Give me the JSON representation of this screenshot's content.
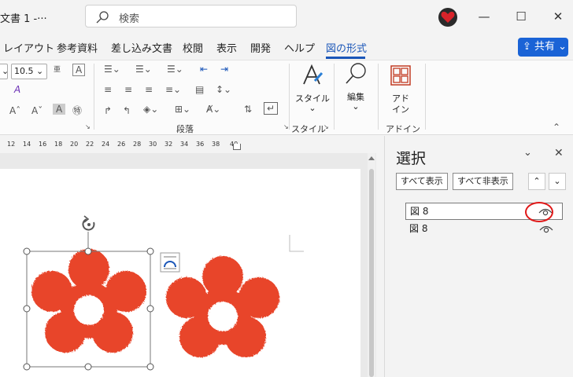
{
  "window": {
    "title": "文書 1  -···",
    "search_placeholder": "検索",
    "minimize": "—",
    "maximize": "☐",
    "close": "✕"
  },
  "menu_tabs": [
    {
      "label": "レイアウト",
      "active": false
    },
    {
      "label": "参考資料",
      "active": false
    },
    {
      "label": "差し込み文書",
      "active": false
    },
    {
      "label": "校閲",
      "active": false
    },
    {
      "label": "表示",
      "active": false
    },
    {
      "label": "開発",
      "active": false
    },
    {
      "label": "ヘルプ",
      "active": false
    },
    {
      "label": "図の形式",
      "active": true
    }
  ],
  "share_button": "共有",
  "ribbon": {
    "font_size": "10.5",
    "paragraph_group": "段落",
    "style_group": "スタイル",
    "style_button": "スタイル",
    "edit_button": "編集",
    "addin_button_line1": "アド",
    "addin_button_line2": "イン",
    "addin_group": "アドイン"
  },
  "ruler_ticks": [
    "12",
    "14",
    "16",
    "18",
    "20",
    "22",
    "24",
    "26",
    "28",
    "30",
    "32",
    "34",
    "36",
    "38",
    "40"
  ],
  "selection_pane": {
    "title": "選択",
    "show_all": "すべて表示",
    "hide_all": "すべて非表示",
    "items": [
      {
        "label": "図 8",
        "selected": true
      },
      {
        "label": "図 8",
        "selected": false
      }
    ]
  },
  "colors": {
    "flower": "#e8452c",
    "accent_blue": "#1a56b8",
    "highlight_red": "#e01818"
  }
}
